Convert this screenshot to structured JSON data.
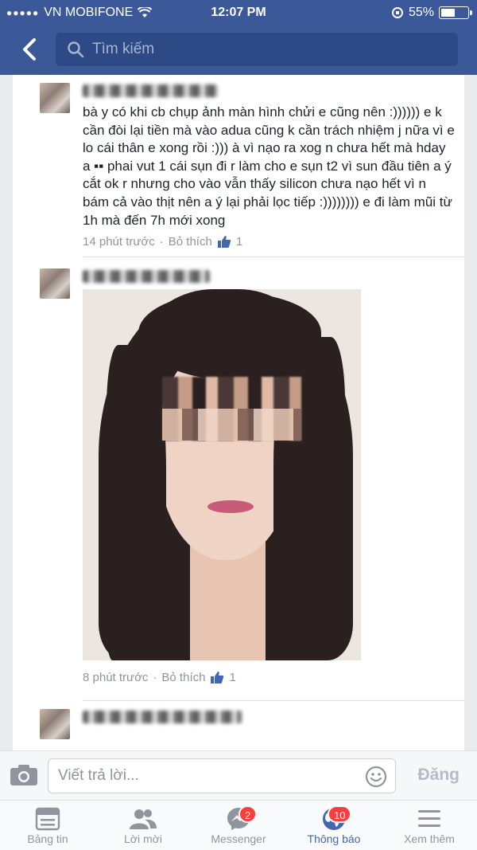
{
  "status_bar": {
    "signal_dots": "●●●●●",
    "carrier": "VN MOBIFONE",
    "time": "12:07 PM",
    "battery_percent": "55%",
    "battery_level": 0.55
  },
  "nav": {
    "search_placeholder": "Tìm kiếm"
  },
  "comments": [
    {
      "text": "bà y có khi cb chụp ảnh màn hình chửi e cũng nên :)))))) e k cần đòi lại tiền mà vào adua cũng k cần trách nhiệm j nữa vì e lo cái thân e xong rồi :))) à vì nạo ra xog n chưa hết mà hday a ▪▪ phai vut 1 cái sụn đi r làm cho e sụn t2 vì sun đầu tiên a ý cắt ok r nhưng cho vào vẫn thấy silicon chưa nạo hết vì n bám cả vào thịt nên a ý lại phải lọc tiếp :)))))))) e đi làm mũi từ 1h mà đến 7h mới xong",
      "time": "14 phút trước",
      "sep": "·",
      "like_label": "Bỏ thích",
      "likes": "1"
    },
    {
      "time": "8 phút trước",
      "sep": "·",
      "like_label": "Bỏ thích",
      "likes": "1"
    }
  ],
  "reply": {
    "placeholder": "Viết trả lời...",
    "post_label": "Đăng"
  },
  "tabs": [
    {
      "label": "Bảng tin",
      "icon": "news-feed-icon"
    },
    {
      "label": "Lời mời",
      "icon": "friend-requests-icon"
    },
    {
      "label": "Messenger",
      "icon": "messenger-icon",
      "badge": "2"
    },
    {
      "label": "Thông báo",
      "icon": "globe-icon",
      "badge": "10",
      "active": true
    },
    {
      "label": "Xem thêm",
      "icon": "menu-icon"
    }
  ],
  "colors": {
    "brand": "#3b5998",
    "active_tab": "#4267b2",
    "badge": "#fa3e3e"
  }
}
